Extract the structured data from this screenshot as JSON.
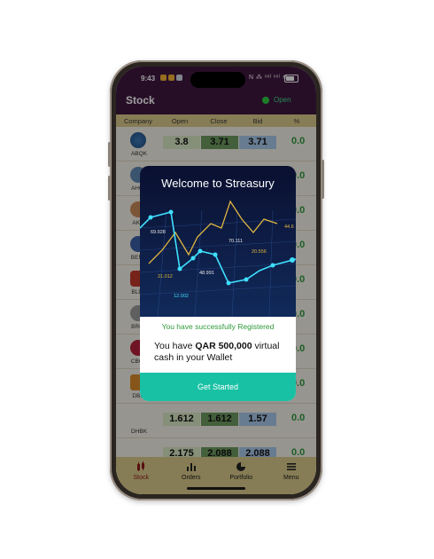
{
  "status": {
    "time": "9:43",
    "right_icons": "N ⁂ ᵛᵒˡ ᵛᵒˡ ≋"
  },
  "header": {
    "title": "Stock",
    "market_status": "Open"
  },
  "columns": [
    "Company",
    "Open",
    "Close",
    "Bid",
    "%"
  ],
  "rows": [
    {
      "code": "ABQK",
      "open": "3.8",
      "close": "3.71",
      "bid": "3.71",
      "pct": "0.0"
    },
    {
      "code": "AHCS",
      "open": "",
      "close": "",
      "bid": "",
      "pct": "0.0"
    },
    {
      "code": "AKHI",
      "open": "",
      "close": "",
      "bid": "",
      "pct": "0.0"
    },
    {
      "code": "BEMA",
      "open": "",
      "close": "",
      "bid": "",
      "pct": "0.0"
    },
    {
      "code": "BLDN",
      "open": "",
      "close": "",
      "bid": "",
      "pct": "0.0"
    },
    {
      "code": "BRES",
      "open": "",
      "close": "",
      "bid": "",
      "pct": "0.0"
    },
    {
      "code": "CBQK",
      "open": "",
      "close": "",
      "bid": "",
      "pct": "0.0"
    },
    {
      "code": "DBIS",
      "open": "",
      "close": "",
      "bid": "",
      "pct": "0.0"
    },
    {
      "code": "DHBK",
      "open": "1.612",
      "close": "1.612",
      "bid": "1.57",
      "pct": "0.0"
    },
    {
      "code": "",
      "open": "2.175",
      "close": "2.088",
      "bid": "2.088",
      "pct": "0.0"
    }
  ],
  "modal": {
    "title": "Welcome to Streasury",
    "chart_labels": [
      "69.928",
      "70.111",
      "44.6",
      "20.556",
      "48.991",
      "21.012",
      "12.002"
    ],
    "success": "You have successfully Registered",
    "msg_prefix": "You have ",
    "amount": "QAR 500,000",
    "msg_suffix": " virtual cash in your Wallet",
    "button": "Get Started"
  },
  "nav": [
    {
      "label": "Stock",
      "icon": "stock-icon",
      "active": true
    },
    {
      "label": "Orders",
      "icon": "orders-icon",
      "active": false
    },
    {
      "label": "Portfolio",
      "icon": "portfolio-icon",
      "active": false
    },
    {
      "label": "Menu",
      "icon": "menu-icon",
      "active": false
    }
  ],
  "colors": {
    "accent": "#19c1a4",
    "header": "#3f1840",
    "gold": "#d8c98a",
    "positive": "#2e9a3a"
  }
}
